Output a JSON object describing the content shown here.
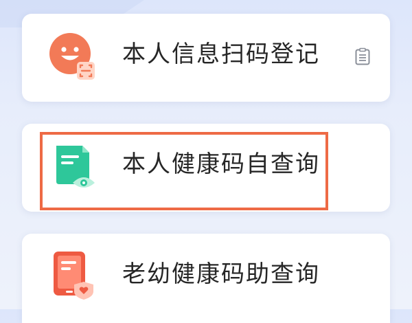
{
  "colors": {
    "background": "#e4ebfb",
    "card": "#ffffff",
    "text": "#262626",
    "highlight": "#ee6a45",
    "face_orange": "#f27a57",
    "doc_green": "#2ec79a",
    "doc_red": "#ee5a42"
  },
  "cards": [
    {
      "label": "本人信息扫码登记",
      "icon": "smiley-scan-icon",
      "side_icon": "clipboard-icon"
    },
    {
      "label": "本人健康码自查询",
      "icon": "document-eye-icon",
      "highlighted": true
    },
    {
      "label": "老幼健康码助查询",
      "icon": "phone-shield-icon"
    }
  ]
}
